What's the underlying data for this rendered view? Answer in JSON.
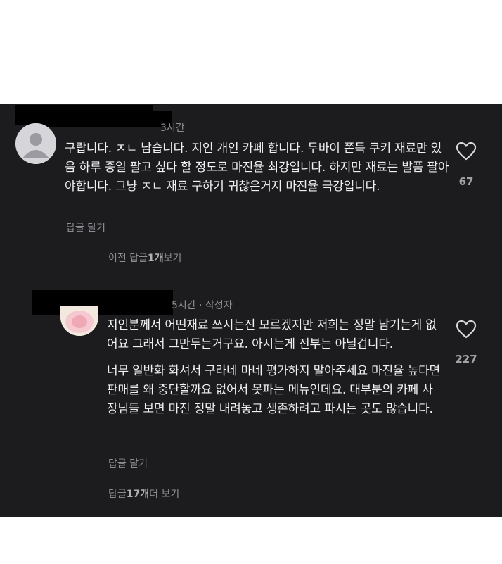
{
  "comments": [
    {
      "time": "3시간",
      "author_badge": "",
      "paragraphs": [
        "구랍니다. ㅈㄴ 남습니다. 지인 개인 카페 합니다. 두바이 쫀득 쿠키 재료만 있음 하루 종일 팔고 싶다 할 정도로 마진율 최강입니다. 하지만 재료는 발품 팔아야합니다. 그냥 ㅈㄴ 재료 구하기 귀찮은거지 마진율 극강입니다."
      ],
      "likes": "67",
      "reply_label": "답글 달기",
      "thread_prefix": "이전 답글 ",
      "thread_count": "1개",
      "thread_suffix": " 보기"
    },
    {
      "time": "5시간",
      "author_badge": "· 작성자",
      "paragraphs": [
        "지인분께서 어떤재료 쓰시는진 모르겠지만 저희는 정말 남기는게 없어요 그래서 그만두는거구요. 아시는게 전부는 아닐겁니다.",
        "너무 일반화 화셔서 구라네 마네 평가하지 말아주세요 마진율 높다면 판매를 왜 중단할까요 없어서 못파는 메뉴인데요. 대부분의 카페 사장님들 보면 마진 정말 내려놓고 생존하려고 파시는 곳도 많습니다."
      ],
      "likes": "227",
      "reply_label": "답글 달기",
      "thread_prefix": "답글 ",
      "thread_count": "17개",
      "thread_suffix": " 더 보기"
    }
  ],
  "colors": {
    "background": "#1c1c1f",
    "text": "#f0f0f0",
    "muted": "#8e8e93",
    "redaction": "#000000"
  },
  "icons": {
    "like": "heart-outline-icon",
    "avatar_default": "default-avatar-icon"
  }
}
